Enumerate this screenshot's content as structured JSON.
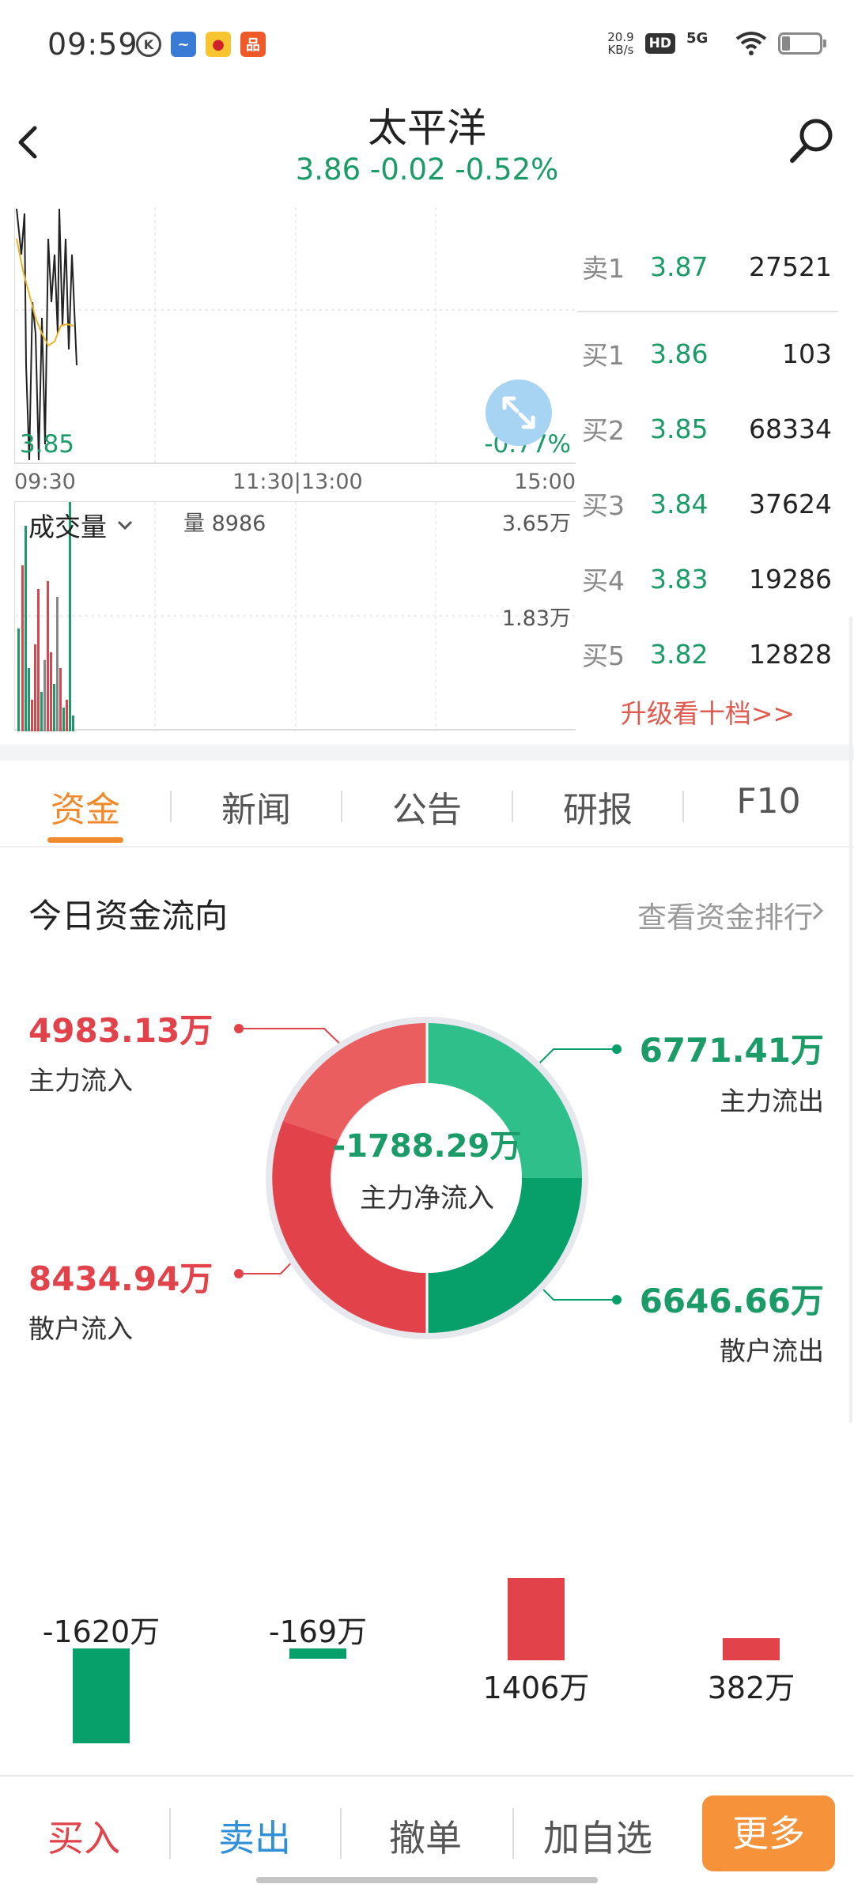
{
  "status_bar": {
    "time": "09:59",
    "net_speed_value": "20.9",
    "net_speed_unit": "KB/s",
    "hd_label": "HD",
    "network": "5G",
    "icons": [
      "k-app-icon",
      "stock-app-icon",
      "weibo-icon",
      "shopping-app-icon",
      "wifi-icon",
      "battery-icon"
    ]
  },
  "header": {
    "title": "太平洋",
    "quote": "3.86 -0.02 -0.52%"
  },
  "chart": {
    "low_price": "3.85",
    "change_pct": "-0.77%",
    "time_start": "09:30",
    "time_mid": "11:30|13:00",
    "time_end": "15:00"
  },
  "volume": {
    "label": "成交量",
    "qty": "量 8986",
    "max": "3.65万",
    "mid": "1.83万"
  },
  "order_book": {
    "sell": [
      {
        "label": "卖1",
        "price": "3.87",
        "volume": "27521"
      }
    ],
    "buy": [
      {
        "label": "买1",
        "price": "3.86",
        "volume": "103"
      },
      {
        "label": "买2",
        "price": "3.85",
        "volume": "68334"
      },
      {
        "label": "买3",
        "price": "3.84",
        "volume": "37624"
      },
      {
        "label": "买4",
        "price": "3.83",
        "volume": "19286"
      },
      {
        "label": "买5",
        "price": "3.82",
        "volume": "12828"
      }
    ],
    "upgrade_link": "升级看十档>>"
  },
  "tabs": [
    "资金",
    "新闻",
    "公告",
    "研报",
    "F10"
  ],
  "fund_flow": {
    "title": "今日资金流向",
    "ranking_link": "查看资金排行",
    "main_in_value": "4983.13万",
    "main_in_label": "主力流入",
    "retail_in_value": "8434.94万",
    "retail_in_label": "散户流入",
    "main_out_value": "6771.41万",
    "main_out_label": "主力流出",
    "retail_out_value": "6646.66万",
    "retail_out_label": "散户流出",
    "net_value": "-1788.29万",
    "net_label": "主力净流入",
    "colors": {
      "inflow": "#e2424a",
      "inflow_light": "#ea5e60",
      "outflow": "#07a06b",
      "outflow_light": "#2fbf8a"
    }
  },
  "chart_data": {
    "type": "bar",
    "categories": [
      "",
      "",
      "",
      ""
    ],
    "values": [
      -1620,
      -169,
      1406,
      382
    ],
    "value_labels": [
      "-1620万",
      "-169万",
      "1406万",
      "382万"
    ],
    "colors": {
      "negative": "#07a06b",
      "positive": "#e2424a"
    }
  },
  "toolbar": {
    "buy": "买入",
    "sell": "卖出",
    "cancel": "撤单",
    "add_watch": "加自选",
    "more": "更多"
  }
}
